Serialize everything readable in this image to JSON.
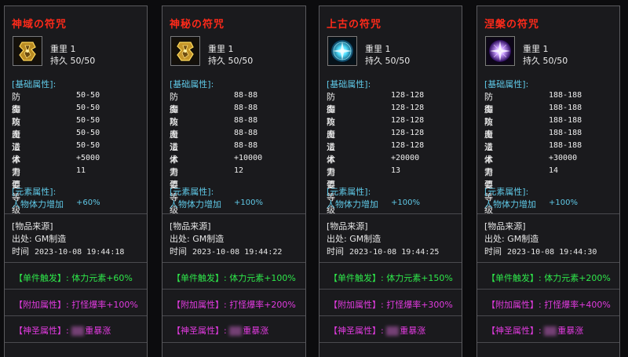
{
  "cards": [
    {
      "title": "神域の符咒",
      "icon": "talisman-gold-icon",
      "weight": "重里 1",
      "durability": "持久 50/50",
      "base_header": "[基础属性]:",
      "stats": [
        {
          "k": "防御",
          "v": "50-50"
        },
        {
          "k": "魔防",
          "v": "50-50"
        },
        {
          "k": "攻击",
          "v": "50-50"
        },
        {
          "k": "魔法",
          "v": "50-50"
        },
        {
          "k": "道术",
          "v": "50-50"
        },
        {
          "k": "体力值",
          "v": "+5000"
        },
        {
          "k": "需要等级",
          "v": "11"
        }
      ],
      "elem_header": "[元素属性]:",
      "elem_k": "人物体力增加",
      "elem_v": "+60%",
      "src_header": "[物品来源]",
      "src_from": "出处: GM制造",
      "src_time_k": "时间",
      "src_time_v": "2023-10-08 19:44:18",
      "trigger": "【单件触发】: 体力元素+60%",
      "addon": "【附加属性】: 打怪爆率+100%",
      "holy": "【神圣属性】:",
      "holy_v": "重暴涨"
    },
    {
      "title": "神秘の符咒",
      "icon": "talisman-gold-icon",
      "weight": "重里 1",
      "durability": "持久 50/50",
      "base_header": "[基础属性]:",
      "stats": [
        {
          "k": "防御",
          "v": "88-88"
        },
        {
          "k": "魔防",
          "v": "88-88"
        },
        {
          "k": "攻击",
          "v": "88-88"
        },
        {
          "k": "魔法",
          "v": "88-88"
        },
        {
          "k": "道术",
          "v": "88-88"
        },
        {
          "k": "体力值",
          "v": "+10000"
        },
        {
          "k": "需要等级",
          "v": "12"
        }
      ],
      "elem_header": "[元素属性]:",
      "elem_k": "人物体力增加",
      "elem_v": "+100%",
      "src_header": "[物品来源]",
      "src_from": "出处: GM制造",
      "src_time_k": "时间",
      "src_time_v": "2023-10-08 19:44:22",
      "trigger": "【单件触发】: 体力元素+100%",
      "addon": "【附加属性】: 打怪爆率+200%",
      "holy": "【神圣属性】:",
      "holy_v": "重暴涨"
    },
    {
      "title": "上古の符咒",
      "icon": "talisman-cyan-orb-icon",
      "weight": "重里 1",
      "durability": "持久 50/50",
      "base_header": "[基础属性]:",
      "stats": [
        {
          "k": "防御",
          "v": "128-128"
        },
        {
          "k": "魔防",
          "v": "128-128"
        },
        {
          "k": "攻击",
          "v": "128-128"
        },
        {
          "k": "魔法",
          "v": "128-128"
        },
        {
          "k": "道术",
          "v": "128-128"
        },
        {
          "k": "体力值",
          "v": "+20000"
        },
        {
          "k": "需要等级",
          "v": "13"
        }
      ],
      "elem_header": "[元素属性]:",
      "elem_k": "人物体力增加",
      "elem_v": "+100%",
      "src_header": "[物品来源]",
      "src_from": "出处: GM制造",
      "src_time_k": "时间",
      "src_time_v": "2023-10-08 19:44:25",
      "trigger": "【单件触发】: 体力元素+150%",
      "addon": "【附加属性】: 打怪爆率+300%",
      "holy": "【神圣属性】:",
      "holy_v": "重暴涨"
    },
    {
      "title": "涅槃の符咒",
      "icon": "talisman-violet-orb-icon",
      "weight": "重里 1",
      "durability": "持久 50/50",
      "base_header": "[基础属性]:",
      "stats": [
        {
          "k": "防御",
          "v": "188-188"
        },
        {
          "k": "魔防",
          "v": "188-188"
        },
        {
          "k": "攻击",
          "v": "188-188"
        },
        {
          "k": "魔法",
          "v": "188-188"
        },
        {
          "k": "道术",
          "v": "188-188"
        },
        {
          "k": "体力值",
          "v": "+30000"
        },
        {
          "k": "需要等级",
          "v": "14"
        }
      ],
      "elem_header": "[元素属性]:",
      "elem_k": "人物体力增加",
      "elem_v": "+100%",
      "src_header": "[物品来源]",
      "src_from": "出处: GM制造",
      "src_time_k": "时间",
      "src_time_v": "2023-10-08 19:44:30",
      "trigger": "【单件触发】: 体力元素+200%",
      "addon": "【附加属性】: 打怪爆率+400%",
      "holy": "【神圣属性】:",
      "holy_v": "重暴涨"
    }
  ]
}
